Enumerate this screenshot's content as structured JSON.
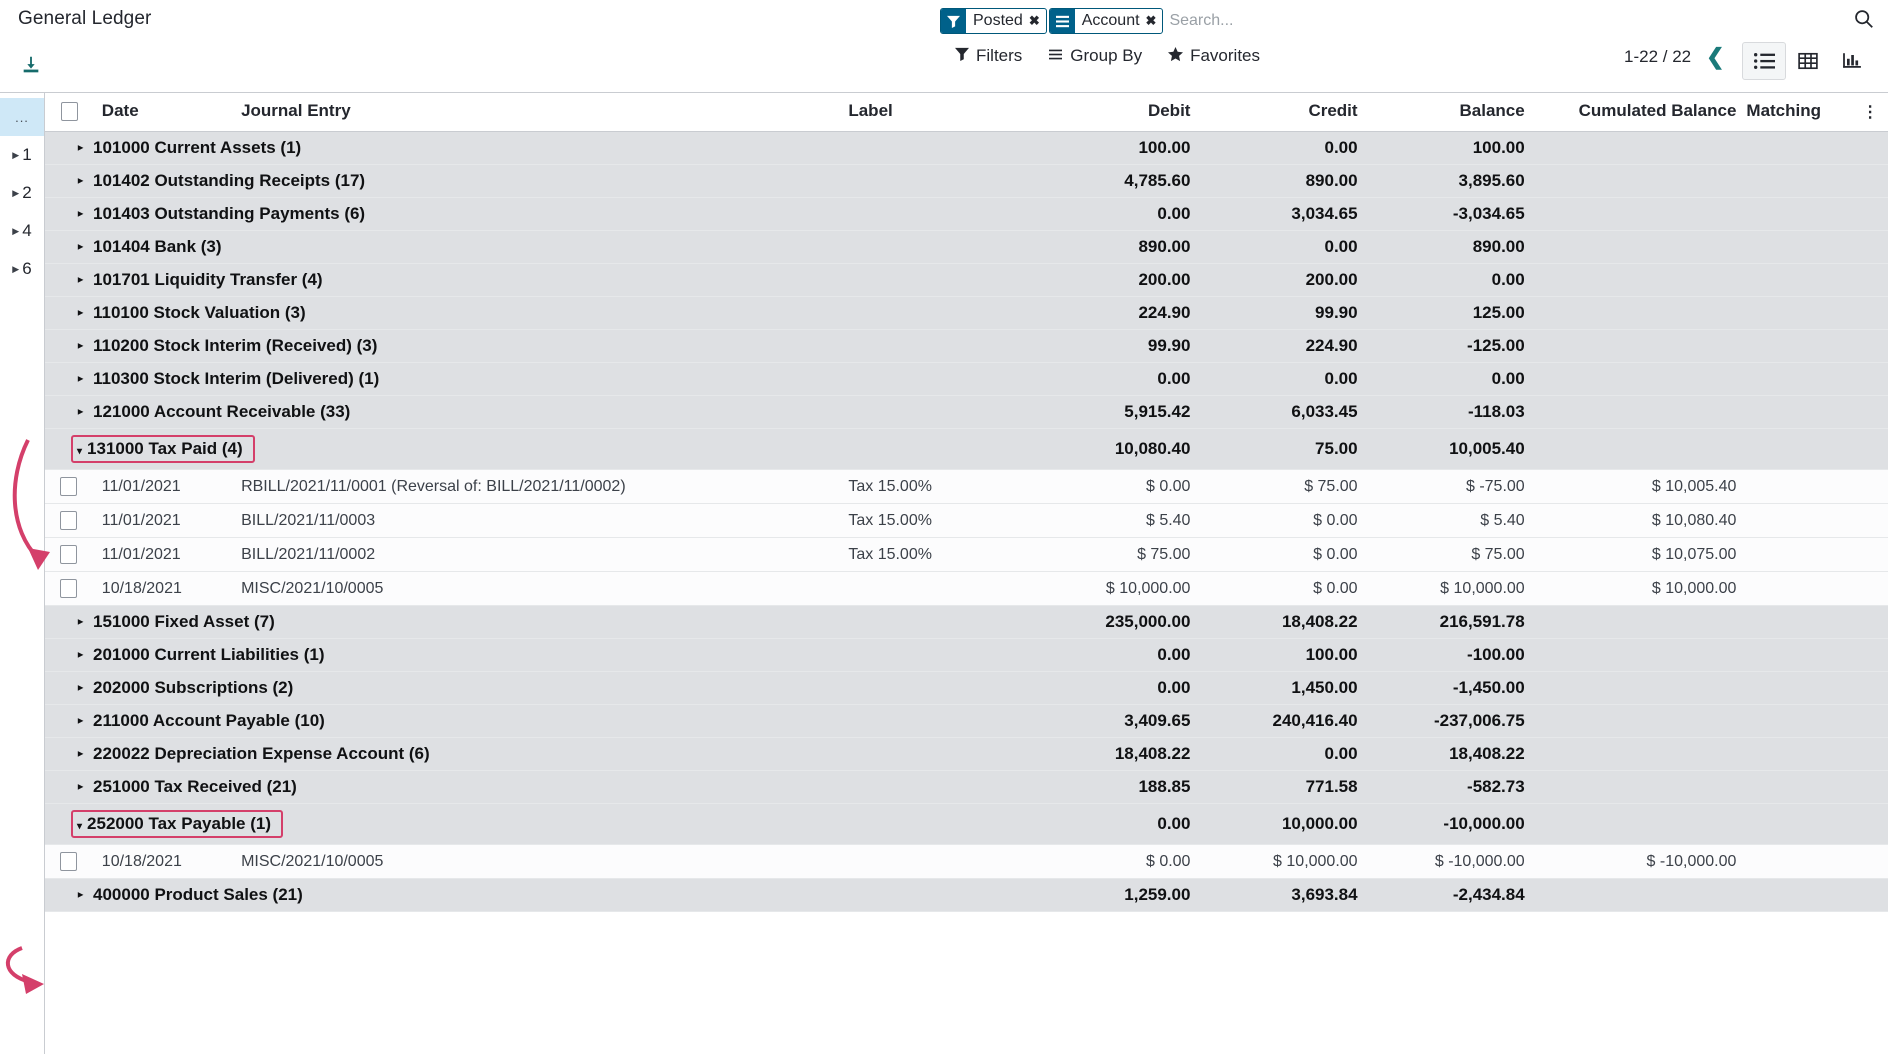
{
  "header": {
    "title": "General Ledger",
    "download_icon": "download-icon",
    "search": {
      "placeholder": "Search...",
      "facets": [
        {
          "icon": "filter-icon",
          "label": "Posted",
          "remove": "✖"
        },
        {
          "icon": "group-by-icon",
          "label": "Account",
          "remove": "✖"
        }
      ],
      "search_icon": "search-icon"
    },
    "menus": [
      {
        "icon": "filter-icon",
        "label": "Filters"
      },
      {
        "icon": "group-by-icon",
        "label": "Group By"
      },
      {
        "icon": "star-icon",
        "label": "Favorites"
      }
    ],
    "pager": {
      "count": "1-22 / 22",
      "prev": "❮",
      "next": "❯"
    },
    "views": [
      {
        "name": "list-view",
        "icon": "list-icon",
        "active": true
      },
      {
        "name": "pivot-view",
        "icon": "grid-icon",
        "active": false
      },
      {
        "name": "graph-view",
        "icon": "bar-chart-icon",
        "active": false
      }
    ]
  },
  "sidebar": {
    "items": [
      {
        "label": "...",
        "selected": true,
        "caret": false
      },
      {
        "label": "1",
        "selected": false,
        "caret": true
      },
      {
        "label": "2",
        "selected": false,
        "caret": true
      },
      {
        "label": "4",
        "selected": false,
        "caret": true
      },
      {
        "label": "6",
        "selected": false,
        "caret": true
      }
    ]
  },
  "table": {
    "columns": {
      "date": "Date",
      "journal_entry": "Journal Entry",
      "label": "Label",
      "debit": "Debit",
      "credit": "Credit",
      "balance": "Balance",
      "cumulated_balance": "Cumulated Balance",
      "matching": "Matching",
      "options_icon": "options-icon"
    },
    "rows": [
      {
        "kind": "group",
        "caret": "▸",
        "name": "101000 Current Assets (1)",
        "debit": "100.00",
        "credit": "0.00",
        "balance": "100.00",
        "cumulated": "",
        "matching": "",
        "highlight": false
      },
      {
        "kind": "group",
        "caret": "▸",
        "name": "101402 Outstanding Receipts (17)",
        "debit": "4,785.60",
        "credit": "890.00",
        "balance": "3,895.60",
        "cumulated": "",
        "matching": "",
        "highlight": false
      },
      {
        "kind": "group",
        "caret": "▸",
        "name": "101403 Outstanding Payments (6)",
        "debit": "0.00",
        "credit": "3,034.65",
        "balance": "-3,034.65",
        "cumulated": "",
        "matching": "",
        "highlight": false
      },
      {
        "kind": "group",
        "caret": "▸",
        "name": "101404 Bank (3)",
        "debit": "890.00",
        "credit": "0.00",
        "balance": "890.00",
        "cumulated": "",
        "matching": "",
        "highlight": false
      },
      {
        "kind": "group",
        "caret": "▸",
        "name": "101701 Liquidity Transfer (4)",
        "debit": "200.00",
        "credit": "200.00",
        "balance": "0.00",
        "cumulated": "",
        "matching": "",
        "highlight": false
      },
      {
        "kind": "group",
        "caret": "▸",
        "name": "110100 Stock Valuation (3)",
        "debit": "224.90",
        "credit": "99.90",
        "balance": "125.00",
        "cumulated": "",
        "matching": "",
        "highlight": false
      },
      {
        "kind": "group",
        "caret": "▸",
        "name": "110200 Stock Interim (Received) (3)",
        "debit": "99.90",
        "credit": "224.90",
        "balance": "-125.00",
        "cumulated": "",
        "matching": "",
        "highlight": false
      },
      {
        "kind": "group",
        "caret": "▸",
        "name": "110300 Stock Interim (Delivered) (1)",
        "debit": "0.00",
        "credit": "0.00",
        "balance": "0.00",
        "cumulated": "",
        "matching": "",
        "highlight": false
      },
      {
        "kind": "group",
        "caret": "▸",
        "name": "121000 Account Receivable (33)",
        "debit": "5,915.42",
        "credit": "6,033.45",
        "balance": "-118.03",
        "cumulated": "",
        "matching": "",
        "highlight": false
      },
      {
        "kind": "group",
        "caret": "▾",
        "name": "131000 Tax Paid (4)",
        "debit": "10,080.40",
        "credit": "75.00",
        "balance": "10,005.40",
        "cumulated": "",
        "matching": "",
        "highlight": true
      },
      {
        "kind": "record",
        "date": "11/01/2021",
        "journal_entry": "RBILL/2021/11/0001 (Reversal of: BILL/2021/11/0002)",
        "label": "Tax 15.00%",
        "debit": "$ 0.00",
        "credit": "$ 75.00",
        "balance": "$ -75.00",
        "cumulated": "$ 10,005.40",
        "matching": ""
      },
      {
        "kind": "record",
        "date": "11/01/2021",
        "journal_entry": "BILL/2021/11/0003",
        "label": "Tax 15.00%",
        "debit": "$ 5.40",
        "credit": "$ 0.00",
        "balance": "$ 5.40",
        "cumulated": "$ 10,080.40",
        "matching": ""
      },
      {
        "kind": "record",
        "date": "11/01/2021",
        "journal_entry": "BILL/2021/11/0002",
        "label": "Tax 15.00%",
        "debit": "$ 75.00",
        "credit": "$ 0.00",
        "balance": "$ 75.00",
        "cumulated": "$ 10,075.00",
        "matching": ""
      },
      {
        "kind": "record",
        "date": "10/18/2021",
        "journal_entry": "MISC/2021/10/0005",
        "label": "",
        "debit": "$ 10,000.00",
        "credit": "$ 0.00",
        "balance": "$ 10,000.00",
        "cumulated": "$ 10,000.00",
        "matching": ""
      },
      {
        "kind": "group",
        "caret": "▸",
        "name": "151000 Fixed Asset (7)",
        "debit": "235,000.00",
        "credit": "18,408.22",
        "balance": "216,591.78",
        "cumulated": "",
        "matching": "",
        "highlight": false
      },
      {
        "kind": "group",
        "caret": "▸",
        "name": "201000 Current Liabilities (1)",
        "debit": "0.00",
        "credit": "100.00",
        "balance": "-100.00",
        "cumulated": "",
        "matching": "",
        "highlight": false
      },
      {
        "kind": "group",
        "caret": "▸",
        "name": "202000 Subscriptions (2)",
        "debit": "0.00",
        "credit": "1,450.00",
        "balance": "-1,450.00",
        "cumulated": "",
        "matching": "",
        "highlight": false
      },
      {
        "kind": "group",
        "caret": "▸",
        "name": "211000 Account Payable (10)",
        "debit": "3,409.65",
        "credit": "240,416.40",
        "balance": "-237,006.75",
        "cumulated": "",
        "matching": "",
        "highlight": false
      },
      {
        "kind": "group",
        "caret": "▸",
        "name": "220022 Depreciation Expense Account (6)",
        "debit": "18,408.22",
        "credit": "0.00",
        "balance": "18,408.22",
        "cumulated": "",
        "matching": "",
        "highlight": false
      },
      {
        "kind": "group",
        "caret": "▸",
        "name": "251000 Tax Received (21)",
        "debit": "188.85",
        "credit": "771.58",
        "balance": "-582.73",
        "cumulated": "",
        "matching": "",
        "highlight": false
      },
      {
        "kind": "group",
        "caret": "▾",
        "name": "252000 Tax Payable (1)",
        "debit": "0.00",
        "credit": "10,000.00",
        "balance": "-10,000.00",
        "cumulated": "",
        "matching": "",
        "highlight": true
      },
      {
        "kind": "record",
        "date": "10/18/2021",
        "journal_entry": "MISC/2021/10/0005",
        "label": "",
        "debit": "$ 0.00",
        "credit": "$ 10,000.00",
        "balance": "$ -10,000.00",
        "cumulated": "$ -10,000.00",
        "matching": ""
      },
      {
        "kind": "group",
        "caret": "▸",
        "name": "400000 Product Sales (21)",
        "debit": "1,259.00",
        "credit": "3,693.84",
        "balance": "-2,434.84",
        "cumulated": "",
        "matching": "",
        "highlight": false
      }
    ]
  },
  "annotations": {
    "highlight_color": "#d43f6a"
  }
}
